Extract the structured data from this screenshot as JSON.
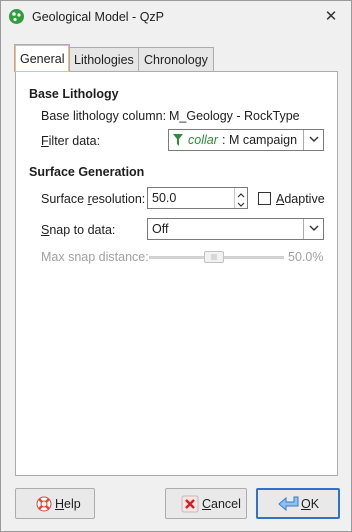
{
  "window": {
    "title": "Geological Model - QzP"
  },
  "tabs": [
    {
      "label": "General",
      "active": true
    },
    {
      "label": "Lithologies",
      "active": false
    },
    {
      "label": "Chronology",
      "active": false
    }
  ],
  "base_lithology": {
    "section_title": "Base Lithology",
    "column_label": "Base lithology column:",
    "column_value": "M_Geology - RockType",
    "filter_label": "Filter data:",
    "filter_prefix": "collar",
    "filter_value": ": M campaign"
  },
  "surface_generation": {
    "section_title": "Surface Generation",
    "resolution_label": "Surface resolution:",
    "resolution_value": "50.0",
    "adaptive_label": "Adaptive",
    "adaptive_checked": false,
    "snap_label": "Snap to data:",
    "snap_value": "Off",
    "max_snap_label": "Max snap distance:",
    "max_snap_value": "50.0%",
    "max_snap_fraction": 0.5,
    "max_snap_enabled": false
  },
  "buttons": {
    "help": "Help",
    "cancel": "Cancel",
    "ok": "OK"
  },
  "colors": {
    "accent": "#2f72c9",
    "filter_icon": "#2e8b3a",
    "cancel_icon": "#cc2222",
    "help_icon": "#d64a3a",
    "ok_icon": "#3a78c8"
  },
  "icons": [
    "app-icon",
    "close-icon",
    "funnel-icon",
    "chevron-down-icon",
    "spin-up-icon",
    "spin-down-icon",
    "lifebuoy-icon",
    "cancel-x-icon",
    "ok-arrow-icon"
  ]
}
